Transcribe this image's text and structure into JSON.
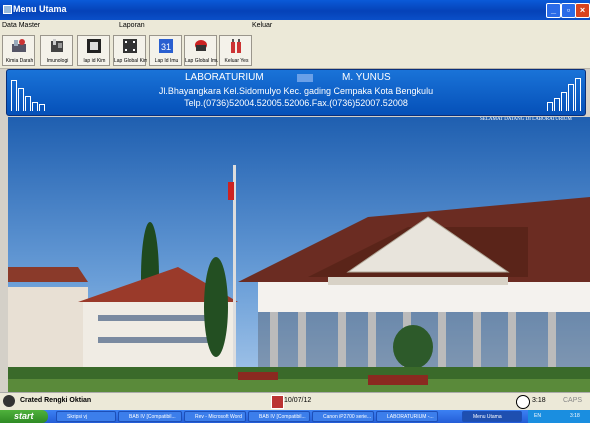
{
  "window": {
    "title": "Menu Utama"
  },
  "menu": [
    "Data Master",
    "Laporan",
    "Keluar"
  ],
  "toolbar": [
    {
      "label": "Kimia Darah",
      "icon": "blood-chemistry-icon"
    },
    {
      "label": "Imunologi",
      "icon": "immunology-icon"
    },
    {
      "label": "lap id Kim",
      "icon": "report-id-icon"
    },
    {
      "label": "Lap Global Kim",
      "icon": "film-report-icon"
    },
    {
      "label": "Lap Id Imu",
      "icon": "calendar-31-icon"
    },
    {
      "label": "Lap Global Imu",
      "icon": "helmet-report-icon"
    },
    {
      "label": "Keluar Yes",
      "icon": "exit-bottles-icon"
    }
  ],
  "header": {
    "lab": "LABORATURIUM",
    "name": "M. YUNUS",
    "address": "Jl.Bhayangkara Kel.Sidomulyo Kec. gading Cempaka Kota Bengkulu",
    "phone": "Telp.(0736)52004.52005.52006.Fax.(0736)52007.52008"
  },
  "marquee": "SELAMAT DATANG DI LABORATURIUM",
  "status": {
    "user": "Crated Rengki Oktian",
    "date": "10/07/12",
    "time": "3:18",
    "caps": "CAPS"
  },
  "taskbar": {
    "start": "start",
    "items": [
      "Skripsi vj",
      "BAB IV [Compatibil...",
      "Rev - Microsoft Word",
      "BAB IV [Compatibil...",
      "Canon iP2700 serie...",
      "LABORATURIUM -...",
      "Menu Utama"
    ],
    "lang": "EN",
    "clock": "3:18"
  },
  "colors": {
    "banner": "#0a5cc8",
    "titlebar": "#0542b8",
    "taskbar": "#245dd7",
    "start": "#3a9b2c"
  }
}
